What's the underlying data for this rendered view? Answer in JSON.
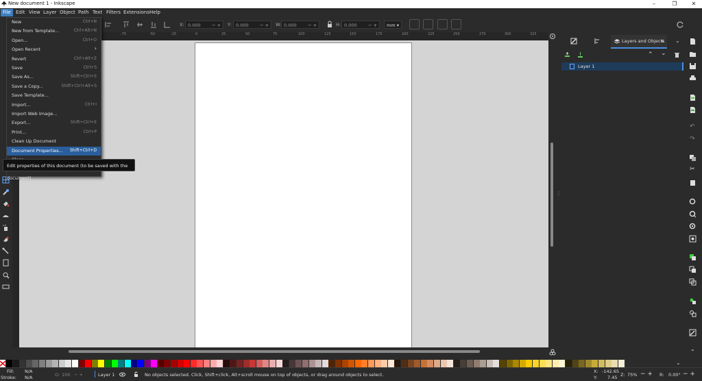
{
  "window": {
    "title": "New document 1 - Inkscape"
  },
  "menubar": [
    "File",
    "Edit",
    "View",
    "Layer",
    "Object",
    "Path",
    "Text",
    "Filters",
    "Extensions",
    "Help"
  ],
  "toolbar": {
    "x_label": "X:",
    "x_value": "0.000",
    "y_label": "Y:",
    "y_value": "0.000",
    "w_label": "W:",
    "w_value": "0.000",
    "h_label": "H:",
    "h_value": "0.000",
    "unit": "mm"
  },
  "file_menu": [
    {
      "label": "New",
      "shortcut": "Ctrl+N"
    },
    {
      "label": "New from Template...",
      "shortcut": "Ctrl+Alt+N"
    },
    {
      "label": "Open...",
      "shortcut": "Ctrl+O"
    },
    {
      "label": "Open Recent",
      "shortcut": "›"
    },
    {
      "label": "Revert",
      "shortcut": "Ctrl+Alt+Z"
    },
    {
      "label": "Save",
      "shortcut": "Ctrl+S"
    },
    {
      "label": "Save As...",
      "shortcut": "Shift+Ctrl+S"
    },
    {
      "label": "Save a Copy...",
      "shortcut": "Shift+Ctrl+Alt+S"
    },
    {
      "label": "Save Template...",
      "shortcut": ""
    },
    {
      "label": "Import...",
      "shortcut": "Ctrl+I"
    },
    {
      "label": "Import Web Image...",
      "shortcut": ""
    },
    {
      "label": "Export...",
      "shortcut": "Shift+Ctrl+E"
    },
    {
      "label": "Print...",
      "shortcut": "Ctrl+P"
    },
    {
      "label": "Clean Up Document",
      "shortcut": ""
    },
    {
      "label": "Document Properties...",
      "shortcut": "Shift+Ctrl+D"
    },
    {
      "label": "Close",
      "shortcut": ""
    }
  ],
  "tooltip": "Edit properties of this document (to be saved with the document)",
  "ruler_labels": [
    "-75",
    "-50",
    "-25",
    "0",
    "25",
    "50",
    "75",
    "100",
    "125",
    "150",
    "175",
    "200",
    "225",
    "250",
    "275",
    "300",
    "325"
  ],
  "dock": {
    "tab_label": "Layers and Objects",
    "layer_name": "Layer 1"
  },
  "status": {
    "fill_label": "Fill:",
    "fill_value": "N/A",
    "stroke_label": "Stroke:",
    "stroke_value": "N/A",
    "opacity_label": "O:",
    "opacity_value": "100",
    "layer": "Layer 1",
    "message": "No objects selected. Click, Shift+click, Alt+scroll mouse on top of objects, or drag around objects to select.",
    "x_label": "X:",
    "x_value": "-142.65",
    "y_label": "Y:",
    "y_value": "7.45",
    "zoom_label": "Z:",
    "zoom_value": "75%",
    "rot_label": "R:",
    "rot_value": "0.00°"
  },
  "palette_colors": [
    "#000000",
    "#1a1a1a",
    "#333333",
    "#4d4d4d",
    "#666666",
    "#808080",
    "#999999",
    "#b3b3b3",
    "#cccccc",
    "#e6e6e6",
    "#ffffff",
    "#800000",
    "#ff0000",
    "#808000",
    "#ffff00",
    "#008000",
    "#00ff00",
    "#008080",
    "#00ffff",
    "#000080",
    "#0000ff",
    "#800080",
    "#ff00ff",
    "#550000",
    "#800000",
    "#aa0000",
    "#d40000",
    "#ff0000",
    "#ff2a2a",
    "#ff5555",
    "#ff8080",
    "#ffaaaa",
    "#ffd5d5",
    "#280b0b",
    "#501616",
    "#782121",
    "#a02c2c",
    "#c83737",
    "#d35f5f",
    "#de8787",
    "#e9afaf",
    "#f4d7d7",
    "#241c1c",
    "#483737",
    "#6c5353",
    "#916f6f",
    "#ac9393",
    "#c8b7b7",
    "#e3dbdb",
    "#552200",
    "#803300",
    "#aa4400",
    "#d45500",
    "#ff6600",
    "#ff7f2a",
    "#ff9955",
    "#ffb380",
    "#ffccaa",
    "#ffe6d5",
    "#28170b",
    "#502d16",
    "#784421",
    "#a05a2c",
    "#c87137",
    "#d38d5f",
    "#deaa87",
    "#e9c6af",
    "#f4e3d7",
    "#241f1c",
    "#483e37",
    "#6c5d53",
    "#917c6f",
    "#ac9d93",
    "#c8beb7",
    "#e3dedb",
    "#554400",
    "#806600",
    "#aa8800",
    "#d4aa00",
    "#ffcc00",
    "#ffd42a",
    "#ffdd55",
    "#ffe680",
    "#ffeeaa",
    "#fff6d5",
    "#28220b",
    "#504416",
    "#786721",
    "#a0892c",
    "#c8ab37",
    "#d3bc5f",
    "#decd87",
    "#e9ddaf",
    "#f4eed7"
  ]
}
